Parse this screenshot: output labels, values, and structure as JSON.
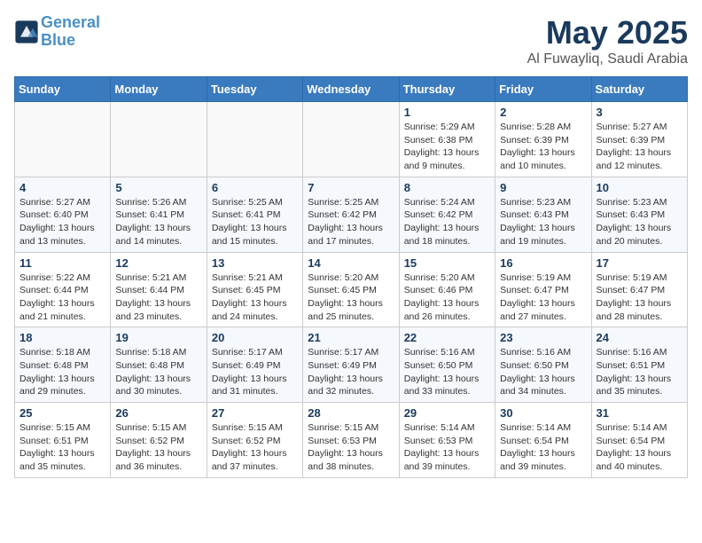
{
  "header": {
    "logo_line1": "General",
    "logo_line2": "Blue",
    "month": "May 2025",
    "location": "Al Fuwayliq, Saudi Arabia"
  },
  "weekdays": [
    "Sunday",
    "Monday",
    "Tuesday",
    "Wednesday",
    "Thursday",
    "Friday",
    "Saturday"
  ],
  "weeks": [
    [
      {
        "day": "",
        "info": ""
      },
      {
        "day": "",
        "info": ""
      },
      {
        "day": "",
        "info": ""
      },
      {
        "day": "",
        "info": ""
      },
      {
        "day": "1",
        "info": "Sunrise: 5:29 AM\nSunset: 6:38 PM\nDaylight: 13 hours\nand 9 minutes."
      },
      {
        "day": "2",
        "info": "Sunrise: 5:28 AM\nSunset: 6:39 PM\nDaylight: 13 hours\nand 10 minutes."
      },
      {
        "day": "3",
        "info": "Sunrise: 5:27 AM\nSunset: 6:39 PM\nDaylight: 13 hours\nand 12 minutes."
      }
    ],
    [
      {
        "day": "4",
        "info": "Sunrise: 5:27 AM\nSunset: 6:40 PM\nDaylight: 13 hours\nand 13 minutes."
      },
      {
        "day": "5",
        "info": "Sunrise: 5:26 AM\nSunset: 6:41 PM\nDaylight: 13 hours\nand 14 minutes."
      },
      {
        "day": "6",
        "info": "Sunrise: 5:25 AM\nSunset: 6:41 PM\nDaylight: 13 hours\nand 15 minutes."
      },
      {
        "day": "7",
        "info": "Sunrise: 5:25 AM\nSunset: 6:42 PM\nDaylight: 13 hours\nand 17 minutes."
      },
      {
        "day": "8",
        "info": "Sunrise: 5:24 AM\nSunset: 6:42 PM\nDaylight: 13 hours\nand 18 minutes."
      },
      {
        "day": "9",
        "info": "Sunrise: 5:23 AM\nSunset: 6:43 PM\nDaylight: 13 hours\nand 19 minutes."
      },
      {
        "day": "10",
        "info": "Sunrise: 5:23 AM\nSunset: 6:43 PM\nDaylight: 13 hours\nand 20 minutes."
      }
    ],
    [
      {
        "day": "11",
        "info": "Sunrise: 5:22 AM\nSunset: 6:44 PM\nDaylight: 13 hours\nand 21 minutes."
      },
      {
        "day": "12",
        "info": "Sunrise: 5:21 AM\nSunset: 6:44 PM\nDaylight: 13 hours\nand 23 minutes."
      },
      {
        "day": "13",
        "info": "Sunrise: 5:21 AM\nSunset: 6:45 PM\nDaylight: 13 hours\nand 24 minutes."
      },
      {
        "day": "14",
        "info": "Sunrise: 5:20 AM\nSunset: 6:45 PM\nDaylight: 13 hours\nand 25 minutes."
      },
      {
        "day": "15",
        "info": "Sunrise: 5:20 AM\nSunset: 6:46 PM\nDaylight: 13 hours\nand 26 minutes."
      },
      {
        "day": "16",
        "info": "Sunrise: 5:19 AM\nSunset: 6:47 PM\nDaylight: 13 hours\nand 27 minutes."
      },
      {
        "day": "17",
        "info": "Sunrise: 5:19 AM\nSunset: 6:47 PM\nDaylight: 13 hours\nand 28 minutes."
      }
    ],
    [
      {
        "day": "18",
        "info": "Sunrise: 5:18 AM\nSunset: 6:48 PM\nDaylight: 13 hours\nand 29 minutes."
      },
      {
        "day": "19",
        "info": "Sunrise: 5:18 AM\nSunset: 6:48 PM\nDaylight: 13 hours\nand 30 minutes."
      },
      {
        "day": "20",
        "info": "Sunrise: 5:17 AM\nSunset: 6:49 PM\nDaylight: 13 hours\nand 31 minutes."
      },
      {
        "day": "21",
        "info": "Sunrise: 5:17 AM\nSunset: 6:49 PM\nDaylight: 13 hours\nand 32 minutes."
      },
      {
        "day": "22",
        "info": "Sunrise: 5:16 AM\nSunset: 6:50 PM\nDaylight: 13 hours\nand 33 minutes."
      },
      {
        "day": "23",
        "info": "Sunrise: 5:16 AM\nSunset: 6:50 PM\nDaylight: 13 hours\nand 34 minutes."
      },
      {
        "day": "24",
        "info": "Sunrise: 5:16 AM\nSunset: 6:51 PM\nDaylight: 13 hours\nand 35 minutes."
      }
    ],
    [
      {
        "day": "25",
        "info": "Sunrise: 5:15 AM\nSunset: 6:51 PM\nDaylight: 13 hours\nand 35 minutes."
      },
      {
        "day": "26",
        "info": "Sunrise: 5:15 AM\nSunset: 6:52 PM\nDaylight: 13 hours\nand 36 minutes."
      },
      {
        "day": "27",
        "info": "Sunrise: 5:15 AM\nSunset: 6:52 PM\nDaylight: 13 hours\nand 37 minutes."
      },
      {
        "day": "28",
        "info": "Sunrise: 5:15 AM\nSunset: 6:53 PM\nDaylight: 13 hours\nand 38 minutes."
      },
      {
        "day": "29",
        "info": "Sunrise: 5:14 AM\nSunset: 6:53 PM\nDaylight: 13 hours\nand 39 minutes."
      },
      {
        "day": "30",
        "info": "Sunrise: 5:14 AM\nSunset: 6:54 PM\nDaylight: 13 hours\nand 39 minutes."
      },
      {
        "day": "31",
        "info": "Sunrise: 5:14 AM\nSunset: 6:54 PM\nDaylight: 13 hours\nand 40 minutes."
      }
    ]
  ]
}
